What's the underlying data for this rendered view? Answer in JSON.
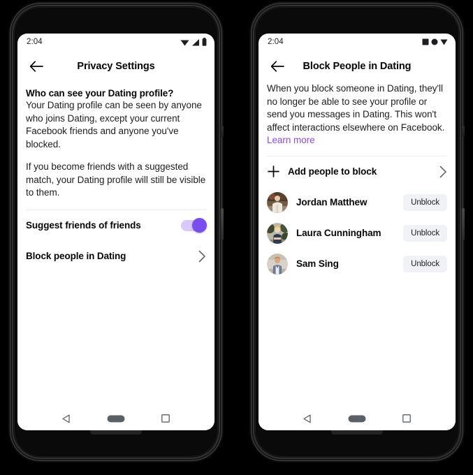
{
  "phones": [
    {
      "id": "privacy-settings",
      "status": {
        "time": "2:04",
        "icons": [
          "wifi-icon",
          "signal-icon",
          "battery-icon"
        ]
      },
      "appbar": {
        "back_icon": "back-arrow-icon",
        "title": "Privacy Settings"
      },
      "content": {
        "section_title": "Who can see your Dating profile?",
        "paragraph_1": "Your Dating profile can be seen by anyone who joins Dating, except your current Facebook friends and anyone you've blocked.",
        "paragraph_2": "If you become friends with a suggested match, your Dating profile will still be visible to them.",
        "rows": [
          {
            "label": "Suggest friends of friends",
            "control": "toggle",
            "toggle_on": true
          },
          {
            "label": "Block people in Dating",
            "control": "chevron"
          }
        ]
      },
      "navbar": [
        "back-triangle-icon",
        "home-pill-icon",
        "recents-square-icon"
      ]
    },
    {
      "id": "block-people-in-dating",
      "status": {
        "time": "2:04",
        "icons": [
          "square-icon",
          "circle-icon",
          "triangle-icon"
        ]
      },
      "appbar": {
        "back_icon": "back-arrow-icon",
        "title": "Block People in Dating"
      },
      "content": {
        "paragraph_1": "When you block someone in Dating, they'll no longer be able to see your profile or send you messages in Dating. This won't affect interactions elsewhere on Facebook.",
        "learn_more": "Learn more",
        "add_row": {
          "label": "Add people to block",
          "icon": "plus-icon",
          "chevron": "chevron-right-icon"
        },
        "people": [
          {
            "name": "Jordan Matthew",
            "action": "Unblock",
            "avatar": "photo-jordan"
          },
          {
            "name": "Laura Cunningham",
            "action": "Unblock",
            "avatar": "photo-laura"
          },
          {
            "name": "Sam Sing",
            "action": "Unblock",
            "avatar": "photo-sam"
          }
        ]
      },
      "navbar": [
        "back-triangle-icon",
        "home-pill-icon",
        "recents-square-icon"
      ]
    }
  ],
  "colors": {
    "accent_purple": "#7a4df0",
    "link_purple": "#8a4ae8",
    "toggle_track": "#d9c8fb",
    "button_grey": "#f0f2f5",
    "text_primary": "#050505",
    "text_secondary": "#1c1e21",
    "divider": "#ebedf0"
  }
}
